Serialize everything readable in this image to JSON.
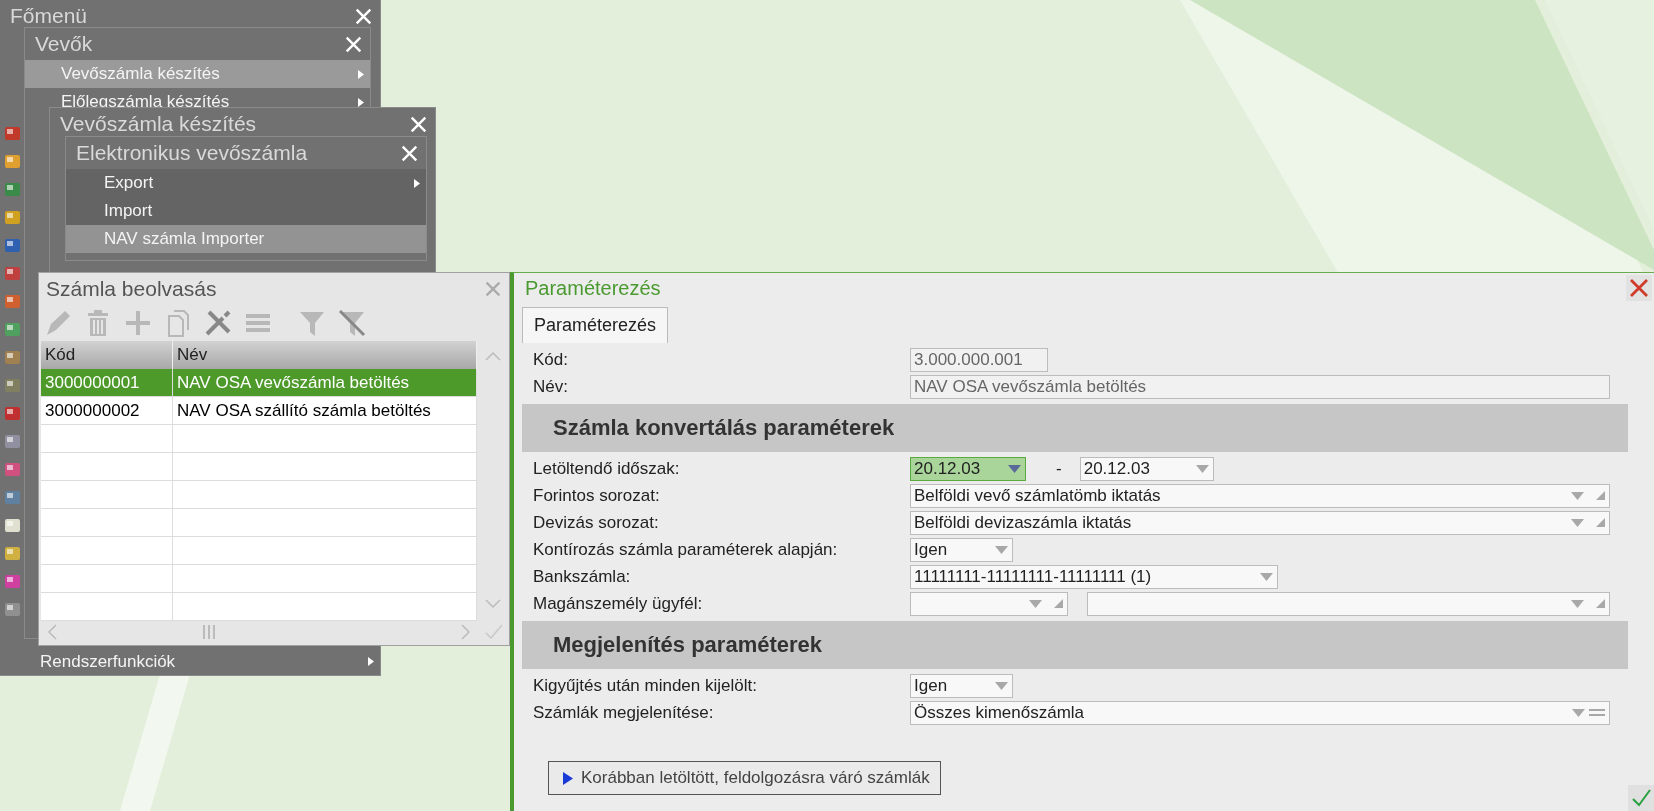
{
  "menus": [
    {
      "title": "Főmenü",
      "items": [
        {
          "label": "Rendszerfunkciók",
          "selected": false,
          "submenu": true
        }
      ]
    },
    {
      "title": "Vevők",
      "items": [
        {
          "label": "Vevőszámla készítés",
          "selected": true,
          "submenu": true
        },
        {
          "label": "Előlegszámla készítés",
          "selected": false,
          "submenu": true
        }
      ]
    },
    {
      "title": "Vevőszámla készítés"
    },
    {
      "title": "Elektronikus vevőszámla",
      "items": [
        {
          "label": "Export",
          "selected": false,
          "submenu": true
        },
        {
          "label": "Import",
          "selected": false,
          "submenu": false
        },
        {
          "label": "NAV számla Importer",
          "selected": true,
          "submenu": false
        }
      ]
    }
  ],
  "list_window": {
    "title": "Számla beolvasás",
    "columns": [
      "Kód",
      "Név"
    ],
    "rows": [
      {
        "cells": [
          "3000000001",
          "NAV OSA vevőszámla betöltés"
        ],
        "selected": true
      },
      {
        "cells": [
          "3000000002",
          "NAV OSA szállító számla betöltés"
        ],
        "selected": false
      }
    ]
  },
  "panel": {
    "title": "Paraméterezés",
    "tabs": [
      {
        "label": "Paraméterezés",
        "selected": true
      }
    ],
    "sections": [
      {
        "fields": [
          {
            "label": "Kód:",
            "controls": [
              {
                "kind": "readonly_short",
                "value": "3.000.000.001"
              }
            ]
          },
          {
            "label": "Név:",
            "controls": [
              {
                "kind": "readonly",
                "value": "NAV OSA vevőszámla betöltés"
              }
            ]
          }
        ]
      },
      {
        "heading": "Számla konvertálás paraméterek",
        "fields": [
          {
            "label": "Letöltendő időszak:",
            "controls": [
              {
                "kind": "date",
                "value": "20.12.03",
                "focused": true
              },
              {
                "kind": "dash",
                "text": "-"
              },
              {
                "kind": "date",
                "value": "20.12.03",
                "focused": false
              }
            ]
          },
          {
            "label": "Forintos sorozat:",
            "controls": [
              {
                "kind": "combo_wide",
                "value": "Belföldi vevő számlatömb iktatás"
              }
            ]
          },
          {
            "label": "Devizás sorozat:",
            "controls": [
              {
                "kind": "combo_wide",
                "value": "Belföldi devizaszámla iktatás"
              }
            ]
          },
          {
            "label": "Kontírozás számla paraméterek alapján:",
            "controls": [
              {
                "kind": "combo_small",
                "value": "Igen"
              }
            ]
          },
          {
            "label": "Bankszámla:",
            "controls": [
              {
                "kind": "combo_medium",
                "value": "11111111-11111111-11111111 (1)"
              }
            ]
          },
          {
            "label": "Magánszemély ügyfél:",
            "controls": [
              {
                "kind": "combo_grip"
              },
              {
                "kind": "combo_wide"
              }
            ]
          }
        ]
      },
      {
        "heading": "Megjelenítés paraméterek",
        "fields": [
          {
            "label": "Kigyűjtés után minden kijelölt:",
            "controls": [
              {
                "kind": "combo_small",
                "value": "Igen"
              }
            ]
          },
          {
            "label": "Számlák megjelenítése:",
            "controls": [
              {
                "kind": "list_wide",
                "value": "Összes kimenőszámla"
              }
            ]
          }
        ]
      }
    ],
    "button": "Korábban letöltött, feldolgozásra váró számlák"
  }
}
